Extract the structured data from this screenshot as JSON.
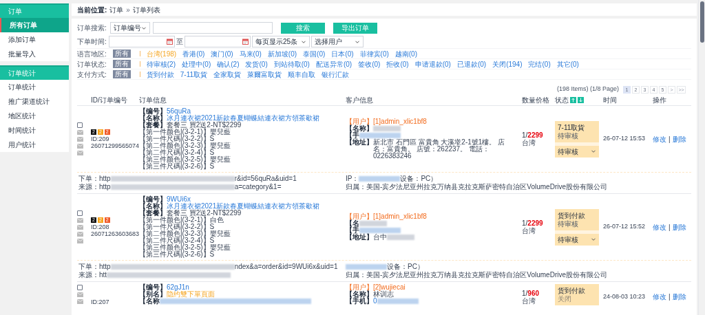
{
  "sidebar": {
    "groups": [
      {
        "title": "订单",
        "items": [
          {
            "label": "所有订单",
            "selected": true
          },
          {
            "label": "添加订单",
            "selected": false
          },
          {
            "label": "批量导入",
            "selected": false
          }
        ]
      },
      {
        "title": "订单统计",
        "items": [
          {
            "label": "订单统计",
            "selected": false
          },
          {
            "label": "推广渠道统计",
            "selected": false
          },
          {
            "label": "地区统计",
            "selected": false
          },
          {
            "label": "时间统计",
            "selected": false
          },
          {
            "label": "用户统计",
            "selected": false
          }
        ]
      }
    ]
  },
  "breadcrumb": {
    "label": "当前位置:",
    "path": [
      "订单",
      "订单列表"
    ],
    "separator": "»"
  },
  "search": {
    "label": "订单搜索:",
    "field_select": "订单编号",
    "buttons": [
      "搜索",
      "导出订单"
    ]
  },
  "time_filter": {
    "label": "下单时间:",
    "separator": "至",
    "per_page": "每页显示25条",
    "user_select": "选择用户"
  },
  "filters": [
    {
      "label": "语言地区:",
      "all": "所有",
      "options": [
        {
          "label": "台湾(198)",
          "selected": true
        },
        {
          "label": "香港(0)",
          "selected": false
        },
        {
          "label": "澳门(0)",
          "selected": false
        },
        {
          "label": "马来(0)",
          "selected": false
        },
        {
          "label": "新加坡(0)",
          "selected": false
        },
        {
          "label": "泰国(0)",
          "selected": false
        },
        {
          "label": "日本(0)",
          "selected": false
        },
        {
          "label": "菲律宾(0)",
          "selected": false
        },
        {
          "label": "越南(0)",
          "selected": false
        }
      ]
    },
    {
      "label": "订单状态:",
      "all": "所有",
      "options": [
        {
          "label": "待审核(2)",
          "selected": false
        },
        {
          "label": "处理中(0)",
          "selected": false
        },
        {
          "label": "确认(2)",
          "selected": false
        },
        {
          "label": "发货(0)",
          "selected": false
        },
        {
          "label": "到站待取(0)",
          "selected": false
        },
        {
          "label": "配送异常(0)",
          "selected": false
        },
        {
          "label": "签收(0)",
          "selected": false
        },
        {
          "label": "拒收(0)",
          "selected": false
        },
        {
          "label": "申请退款(0)",
          "selected": false
        },
        {
          "label": "已退款(0)",
          "selected": false
        },
        {
          "label": "关闭(194)",
          "selected": false
        },
        {
          "label": "完结(0)",
          "selected": false
        },
        {
          "label": "其它(0)",
          "selected": false
        }
      ]
    },
    {
      "label": "支付方式:",
      "all": "所有",
      "options": [
        {
          "label": "货到付款",
          "selected": false
        },
        {
          "label": "7-11取貨",
          "selected": false
        },
        {
          "label": "全家取貨",
          "selected": false
        },
        {
          "label": "萊爾富取貨",
          "selected": false
        },
        {
          "label": "顺丰自取",
          "selected": false
        },
        {
          "label": "银行汇款",
          "selected": false
        }
      ]
    }
  ],
  "pagination": {
    "summary": "(198 Items) (1/8 Page)",
    "pages": [
      {
        "label": "1",
        "selected": true
      },
      {
        "label": "2",
        "selected": false
      },
      {
        "label": "3",
        "selected": false
      },
      {
        "label": "4",
        "selected": false
      },
      {
        "label": "5",
        "selected": false
      }
    ],
    "next": ">",
    "last": ">>"
  },
  "table": {
    "columns": [
      {
        "label": "ID/订单编号",
        "kind": "plain"
      },
      {
        "label": "订单信息",
        "kind": "plain"
      },
      {
        "label": "客户信息",
        "kind": "plain"
      },
      {
        "label": "数量价格",
        "kind": "plain"
      },
      {
        "label": "状态",
        "kind": "sortable"
      },
      {
        "label": "时间",
        "kind": "plain"
      },
      {
        "label": "操作",
        "kind": "plain"
      }
    ],
    "action_separator": "|",
    "rows": [
      {
        "kind": "full",
        "checked": false,
        "tags": [
          {
            "label": "2",
            "color": "#111111"
          },
          {
            "label": "2",
            "color": "#f7a21b"
          },
          {
            "label": "2",
            "color": "#f05a28"
          }
        ],
        "id": "ID:209",
        "order_no": "26071299565074",
        "order_info": [
          [
            {
              "text": "【编号】",
              "kind": "bold"
            },
            {
              "text": "56quRa",
              "kind": "link"
            }
          ],
          [
            {
              "text": "【名称】",
              "kind": "bold"
            },
            {
              "text": "冰月連衣裙2021新款春夏蝴蝶結連衣裙方領茶歇裙",
              "kind": "link"
            }
          ],
          [
            {
              "text": "【套餐】",
              "kind": "bold"
            },
            {
              "text": "套餐三 買2送2-NT$2299",
              "kind": "plain"
            }
          ],
          [
            {
              "text": "【第一件颜色|(3-2-1)】嬰兒藍",
              "kind": "plain"
            }
          ],
          [
            {
              "text": "【第一件尺碼|(3-2-2)】S",
              "kind": "plain"
            }
          ],
          [
            {
              "text": "【第二件颜色|(3-2-3)】嬰兒藍",
              "kind": "plain"
            }
          ],
          [
            {
              "text": "【第二件尺碼|(3-2-4)】S",
              "kind": "plain"
            }
          ],
          [
            {
              "text": "【第三件颜色|(3-2-5)】嬰兒藍",
              "kind": "plain"
            }
          ],
          [
            {
              "text": "【第三件尺碼|(3-2-6)】S",
              "kind": "plain"
            }
          ]
        ],
        "customer": [
          [
            {
              "text": "【用户】",
              "kind": "orange"
            },
            {
              "text": "[1]admin_xlic1bf8",
              "kind": "orange"
            }
          ],
          [
            {
              "text": "【名称】",
              "kind": "bold"
            },
            {
              "kind": "blur"
            }
          ],
          [
            {
              "text": "【手",
              "kind": "bold"
            },
            {
              "kind": "blur_link"
            }
          ],
          [
            {
              "text": "【地址】",
              "kind": "bold"
            },
            {
              "text": "新北市 石門區 富貴角 大溪墘2-1號1樓。 店名：富貴角。 店號：262237。 電話：0226383246",
              "kind": "plain"
            }
          ]
        ],
        "quantity": "1/",
        "price": "2299",
        "region": "台湾",
        "status": {
          "payment": "7-11取貨",
          "state": "待审核",
          "faded": false,
          "select": "待审核"
        },
        "time": "26-07-12 15:53",
        "actions": [
          "修改",
          "删除"
        ],
        "footer": {
          "left": [
            [
              {
                "text": "下单：http",
                "kind": "plain"
              },
              {
                "kind": "blur_long"
              },
              {
                "text": "r&id=56quRa&uid=1",
                "kind": "plain"
              }
            ],
            [
              {
                "text": "来源：http",
                "kind": "plain"
              },
              {
                "kind": "blur_long"
              },
              {
                "text": "a=category&1=",
                "kind": "plain"
              }
            ]
          ],
          "right": [
            [
              {
                "text": "IP：",
                "kind": "plain"
              },
              {
                "kind": "blur_link"
              },
              {
                "text": "设备：PC）",
                "kind": "plain"
              }
            ],
            [
              {
                "text": "归属：美国-宾夕法尼亚州拉克万纳县克拉克斯萨密特自治区VolumeDrive股份有限公司",
                "kind": "plain"
              }
            ]
          ]
        }
      },
      {
        "kind": "full",
        "checked": false,
        "tags": [
          {
            "label": "2",
            "color": "#111111"
          },
          {
            "label": "2",
            "color": "#f7a21b"
          },
          {
            "label": "2",
            "color": "#f05a28"
          }
        ],
        "id": "ID:208",
        "order_no": "26071263603683",
        "order_info": [
          [
            {
              "text": "【编号】",
              "kind": "bold"
            },
            {
              "text": "9WUi6x",
              "kind": "link"
            }
          ],
          [
            {
              "text": "【名称】",
              "kind": "bold"
            },
            {
              "text": "冰月連衣裙2021新款春夏蝴蝶結連衣裙方領茶歇裙",
              "kind": "link"
            }
          ],
          [
            {
              "text": "【套餐】",
              "kind": "bold"
            },
            {
              "text": "套餐三 買2送2-NT$2299",
              "kind": "plain"
            }
          ],
          [
            {
              "text": "【第一件颜色|(3-2-1)】白色",
              "kind": "plain"
            }
          ],
          [
            {
              "text": "【第一件尺碼|(3-2-2)】S",
              "kind": "plain"
            }
          ],
          [
            {
              "text": "【第二件颜色|(3-2-3)】嬰兒藍",
              "kind": "plain"
            }
          ],
          [
            {
              "text": "【第二件尺碼|(3-2-4)】S",
              "kind": "plain"
            }
          ],
          [
            {
              "text": "【第三件颜色|(3-2-5)】嬰兒藍",
              "kind": "plain"
            }
          ],
          [
            {
              "text": "【第三件尺碼|(3-2-6)】S",
              "kind": "plain"
            }
          ]
        ],
        "customer": [
          [
            {
              "text": "【用户】",
              "kind": "orange"
            },
            {
              "text": "[1]admin_xlic1bf8",
              "kind": "orange"
            }
          ],
          [
            {
              "text": "【名",
              "kind": "bold"
            },
            {
              "kind": "blur"
            }
          ],
          [
            {
              "text": "【手",
              "kind": "bold"
            },
            {
              "kind": "blur_link"
            }
          ],
          [
            {
              "text": "【地址】",
              "kind": "bold"
            },
            {
              "text": "台中",
              "kind": "plain"
            },
            {
              "kind": "blur"
            }
          ]
        ],
        "quantity": "1/",
        "price": "2299",
        "region": "台湾",
        "status": {
          "payment": "货到付款",
          "state": "待审核",
          "faded": false,
          "select": "待审核"
        },
        "time": "26-07-12 15:52",
        "actions": [
          "修改",
          "删除"
        ],
        "footer": {
          "left": [
            [
              {
                "text": "下单：http",
                "kind": "plain"
              },
              {
                "kind": "blur_long"
              },
              {
                "text": "ndex&a=order&id=9WUi6x&uid=1",
                "kind": "plain"
              }
            ],
            [
              {
                "text": "来源：htt",
                "kind": "plain"
              },
              {
                "kind": "blur_long"
              }
            ]
          ],
          "right": [
            [
              {
                "kind": "blur_link"
              },
              {
                "text": "设备：PC）",
                "kind": "plain"
              }
            ],
            [
              {
                "text": "归属：美国-宾夕法尼亚州拉克万纳县克拉克斯萨密特自治区VolumeDrive股份有限公司",
                "kind": "plain"
              }
            ]
          ]
        }
      },
      {
        "kind": "cut",
        "checked": false,
        "id": "ID:207",
        "order_info": [
          [
            {
              "text": "【编号】",
              "kind": "bold"
            },
            {
              "text": "62gJ1n",
              "kind": "link"
            }
          ],
          [
            {
              "text": "【别名】",
              "kind": "bold"
            },
            {
              "text": "隐约雙下單頁面",
              "kind": "alias"
            }
          ],
          [
            {
              "text": "【名称",
              "kind": "bold"
            },
            {
              "kind": "blur_link_long"
            }
          ]
        ],
        "customer": [
          [
            {
              "text": "【用户】",
              "kind": "orange"
            },
            {
              "text": "[2]wujiecai",
              "kind": "orange"
            }
          ],
          [
            {
              "text": "【名称】",
              "kind": "bold"
            },
            {
              "text": "林训志",
              "kind": "plain"
            }
          ],
          [
            {
              "text": "【手机】",
              "kind": "bold"
            },
            {
              "text": "0",
              "kind": "link"
            },
            {
              "kind": "blur_link"
            }
          ]
        ],
        "quantity": "1/",
        "price": "960",
        "region": "台湾",
        "status": {
          "payment": "货到付款",
          "state": "关闭",
          "faded": true
        },
        "time": "24-08-03 10:23",
        "actions": [
          "修改",
          "删除"
        ]
      }
    ]
  }
}
